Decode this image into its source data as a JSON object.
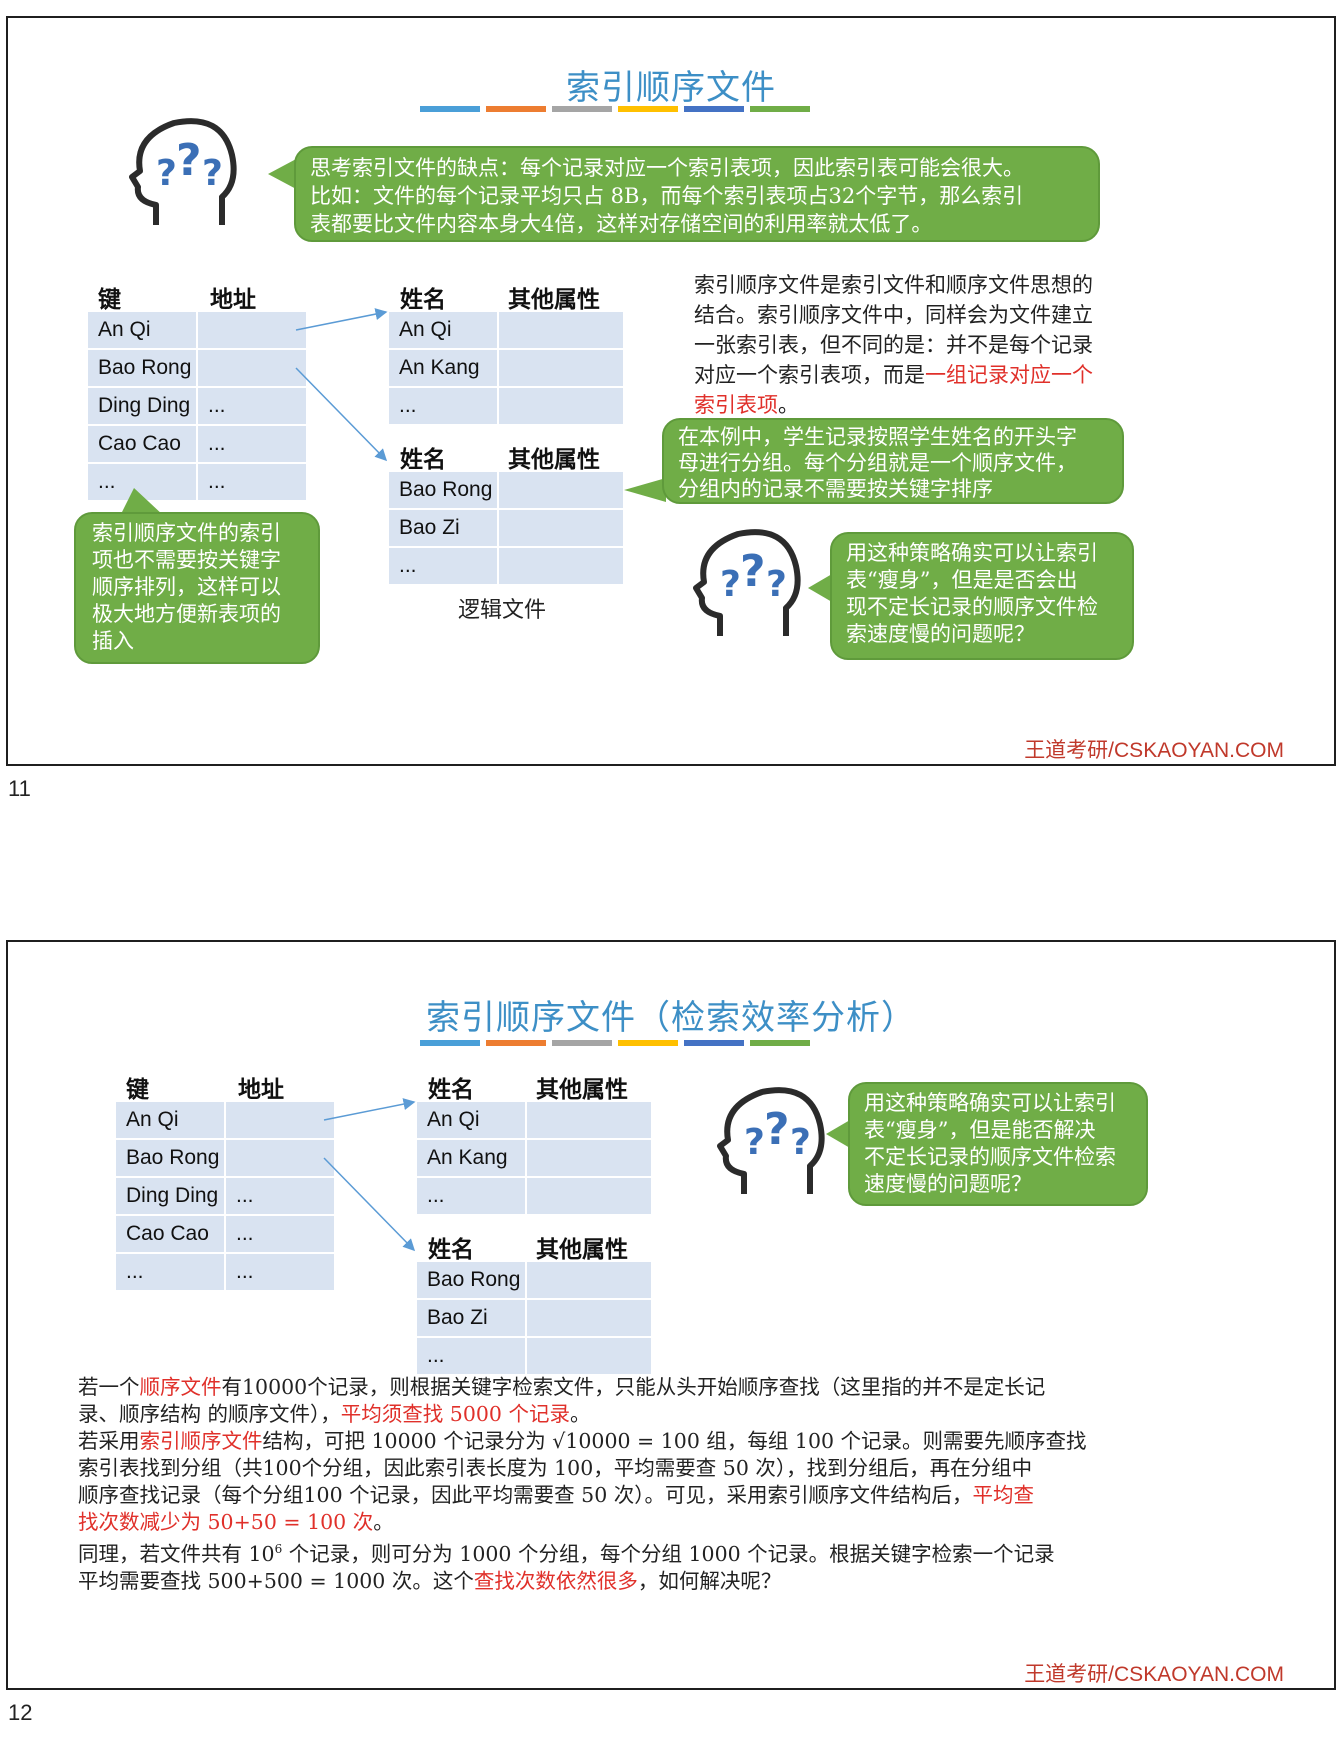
{
  "slide11": {
    "title": "索引顺序文件",
    "deco_colors": [
      "#4a9fd8",
      "#ed7d31",
      "#a5a5a5",
      "#ffc000",
      "#4472c4",
      "#70ad47"
    ],
    "think_bubble": [
      "思考索引文件的缺点：每个记录对应一个索引表项，因此索引表可能会很大。",
      "比如：文件的每个记录平均只占 8B，而每个索引表项占32个字节，那么索引",
      "表都要比文件内容本身大4倍，这样对存储空间的利用率就太低了。"
    ],
    "index_table": {
      "headers": [
        "键",
        "地址"
      ],
      "rows": [
        [
          "An Qi",
          ""
        ],
        [
          "Bao Rong",
          ""
        ],
        [
          "Ding Ding",
          "..."
        ],
        [
          "Cao Cao",
          "..."
        ],
        [
          "...",
          "..."
        ]
      ]
    },
    "group1": {
      "headers": [
        "姓名",
        "其他属性"
      ],
      "rows": [
        [
          "An Qi",
          ""
        ],
        [
          "An Kang",
          ""
        ],
        [
          "...",
          ""
        ]
      ]
    },
    "group2": {
      "headers": [
        "姓名",
        "其他属性"
      ],
      "rows": [
        [
          "Bao Rong",
          ""
        ],
        [
          "Bao Zi",
          ""
        ],
        [
          "...",
          ""
        ]
      ]
    },
    "logic_label": "逻辑文件",
    "desc": {
      "lines": [
        "索引顺序文件是索引文件和顺序文件思想的",
        "结合。索引顺序文件中，同样会为文件建立",
        "一张索引表，但不同的是：并不是每个记录"
      ],
      "line4_normal": "对应一个索引表项，而是",
      "line4_red": "一组记录对应一个",
      "line5_red": "索引表项",
      "line5_normal": "。"
    },
    "group_bubble": [
      "在本例中，学生记录按照学生姓名的开头字",
      "母进行分组。每个分组就是一个顺序文件，",
      "分组内的记录不需要按关键字排序"
    ],
    "left_bubble": [
      "索引顺序文件的索引",
      "项也不需要按关键字",
      "顺序排列，这样可以",
      "极大地方便新表项的",
      "插入"
    ],
    "question_bubble": [
      "用这种策略确实可以让索引",
      "表“瘦身”，但是是否会出",
      "现不定长记录的顺序文件检",
      "索速度慢的问题呢？"
    ],
    "footer": "王道考研/CSKAOYAN.COM",
    "page_number": "11"
  },
  "slide12": {
    "title": "索引顺序文件（检索效率分析）",
    "index_table": {
      "headers": [
        "键",
        "地址"
      ],
      "rows": [
        [
          "An Qi",
          ""
        ],
        [
          "Bao Rong",
          ""
        ],
        [
          "Ding Ding",
          "..."
        ],
        [
          "Cao Cao",
          "..."
        ],
        [
          "...",
          "..."
        ]
      ]
    },
    "group1": {
      "headers": [
        "姓名",
        "其他属性"
      ],
      "rows": [
        [
          "An Qi",
          ""
        ],
        [
          "An Kang",
          ""
        ],
        [
          "...",
          ""
        ]
      ]
    },
    "group2": {
      "headers": [
        "姓名",
        "其他属性"
      ],
      "rows": [
        [
          "Bao Rong",
          ""
        ],
        [
          "Bao Zi",
          ""
        ],
        [
          "...",
          ""
        ]
      ]
    },
    "question_bubble": [
      "用这种策略确实可以让索引",
      "表“瘦身”，但是能否解决",
      "不定长记录的顺序文件检索",
      "速度慢的问题呢？"
    ],
    "para": {
      "l1a": "若一个",
      "l1b": "顺序文件",
      "l1c": "有10000个记录，则根据关键字检索文件，只能从头开始顺序查找（这里指的并不是定长记",
      "l2a": "录、顺序结构 的顺序文件），",
      "l2b": "平均须查找 5000 个记录",
      "l2c": "。",
      "l3a": "若采用",
      "l3b": "索引顺序文件",
      "l3c": "结构，可把 10000 个记录分为 √10000 = 100  组，每组 100 个记录。则需要先顺序查找",
      "l4": "索引表找到分组（共100个分组，因此索引表长度为 100，平均需要查 50 次），找到分组后，再在分组中",
      "l5a": "顺序查找记录（每个分组100 个记录，因此平均需要查 50 次）。可见，采用索引顺序文件结构后，",
      "l5b": "平均查",
      "l6a": "找次数减少为 50+50 = 100 次",
      "l6b": "。",
      "l7a": "同理，若文件共有 10",
      "l7sup": "6",
      "l7b": " 个记录，则可分为 1000 个分组，每个分组 1000 个记录。根据关键字检索一个记录",
      "l8a": "平均需要查找 500+500 = 1000 次。这个",
      "l8b": "查找次数依然很多",
      "l8c": "，如何解决呢？"
    },
    "footer": "王道考研/CSKAOYAN.COM",
    "page_number": "12"
  }
}
